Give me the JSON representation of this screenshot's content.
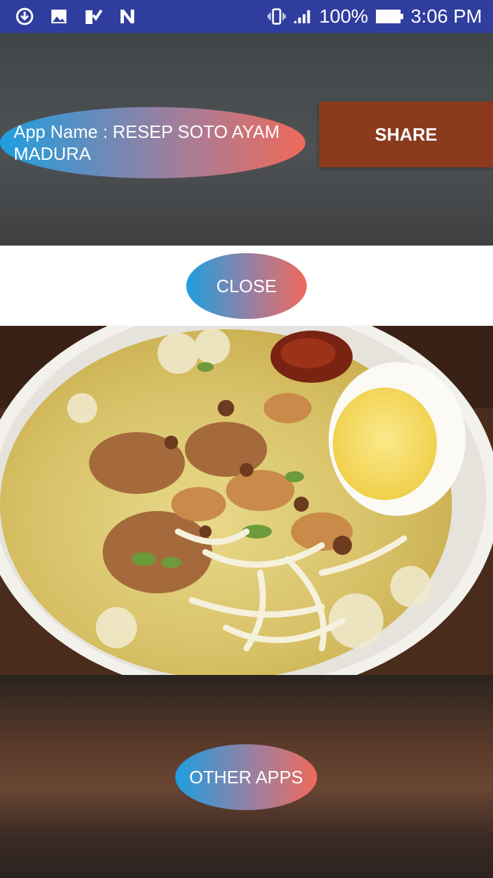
{
  "status_bar": {
    "battery": "100%",
    "time": "3:06 PM",
    "left_icons": [
      "download-icon",
      "image-icon",
      "checklist-icon",
      "n-app-icon"
    ],
    "right_icons": [
      "vibrate-icon",
      "signal-icon",
      "battery-icon"
    ]
  },
  "header": {
    "app_name": "App Name : RESEP SOTO AYAM MADURA",
    "share_label": "SHARE"
  },
  "close_label": "CLOSE",
  "other_apps_label": "OTHER APPS",
  "colors": {
    "status_bar": "#2f3e9e",
    "share_button": "#8b3a1e",
    "gradient_start": "#1e9ee0",
    "gradient_end": "#f06a5a"
  }
}
